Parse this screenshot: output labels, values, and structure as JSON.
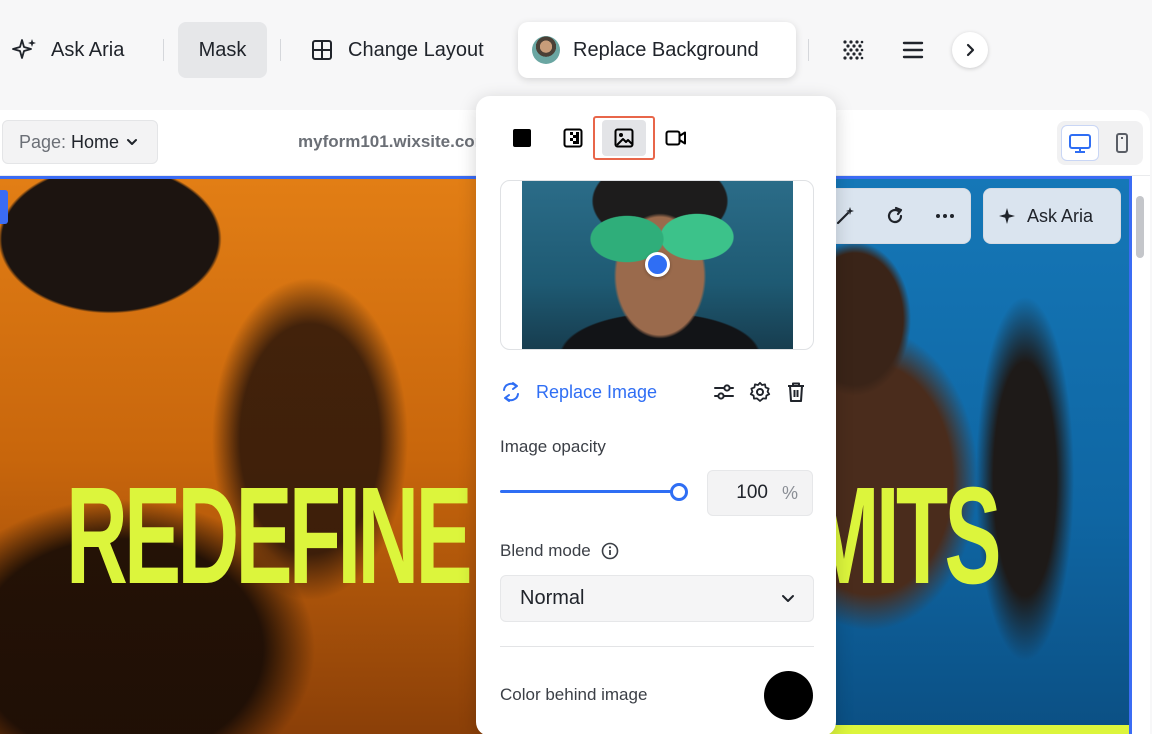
{
  "toolbar": {
    "ask_aria": "Ask Aria",
    "mask": "Mask",
    "change_layout": "Change Layout",
    "replace_background": "Replace Background"
  },
  "editor": {
    "page_label": "Page:",
    "page_value": "Home",
    "url": "myform101.wixsite.com"
  },
  "canvas": {
    "headline": "REDEFINE YOUR LIMITS",
    "ask_aria": "Ask Aria"
  },
  "panel": {
    "selected_bg_type": "image",
    "bg_types": [
      "color",
      "gradient",
      "image",
      "video"
    ],
    "replace_image": "Replace Image",
    "image_opacity_label": "Image opacity",
    "opacity_value": "100",
    "opacity_unit": "%",
    "opacity_fraction": 1.0,
    "blend_mode_label": "Blend mode",
    "blend_mode_value": "Normal",
    "color_behind_label": "Color behind image",
    "color_behind_value": "#000000"
  },
  "colors": {
    "accent": "#2f6ef4",
    "headline": "#dcf53c",
    "selected_highlight": "#e8664a"
  }
}
